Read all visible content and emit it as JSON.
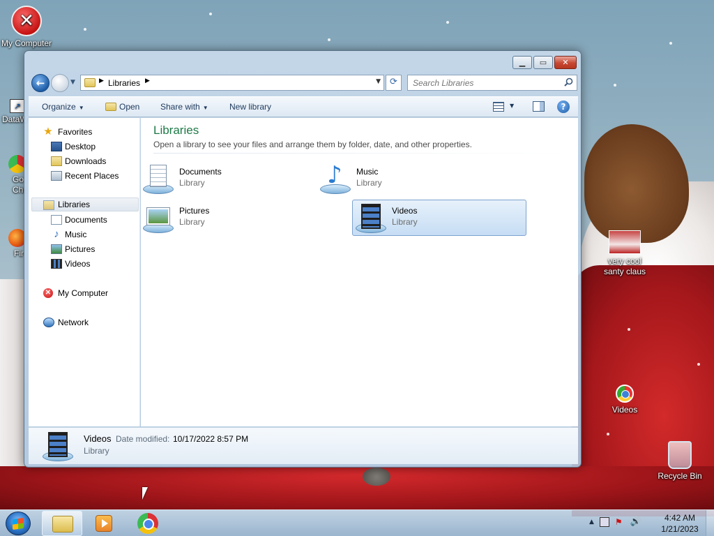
{
  "desktop": {
    "icons": [
      {
        "label": "My Computer"
      },
      {
        "label": "DataW"
      },
      {
        "label": "Go\nChr"
      },
      {
        "label": "Fir"
      },
      {
        "label": "very cool santy claus"
      },
      {
        "label": "Videos"
      },
      {
        "label": "Recycle Bin"
      }
    ]
  },
  "window": {
    "address": {
      "crumb": "Libraries"
    },
    "search": {
      "placeholder": "Search Libraries"
    },
    "toolbar": {
      "organize": "Organize",
      "open": "Open",
      "share_with": "Share with",
      "new_library": "New library"
    },
    "nav": {
      "favorites": "Favorites",
      "desktop": "Desktop",
      "downloads": "Downloads",
      "recent_places": "Recent Places",
      "libraries": "Libraries",
      "documents": "Documents",
      "music": "Music",
      "pictures": "Pictures",
      "videos": "Videos",
      "my_computer": "My Computer",
      "network": "Network"
    },
    "content": {
      "title": "Libraries",
      "description": "Open a library to see your files and arrange them by folder, date, and other properties.",
      "libraries": [
        {
          "name": "Documents",
          "type": "Library"
        },
        {
          "name": "Music",
          "type": "Library"
        },
        {
          "name": "Pictures",
          "type": "Library"
        },
        {
          "name": "Videos",
          "type": "Library"
        }
      ]
    },
    "details": {
      "name": "Videos",
      "modified_label": "Date modified:",
      "modified": "10/17/2022 8:57 PM",
      "type": "Library"
    }
  },
  "taskbar": {
    "time": "4:42 AM",
    "date": "1/21/2023"
  }
}
